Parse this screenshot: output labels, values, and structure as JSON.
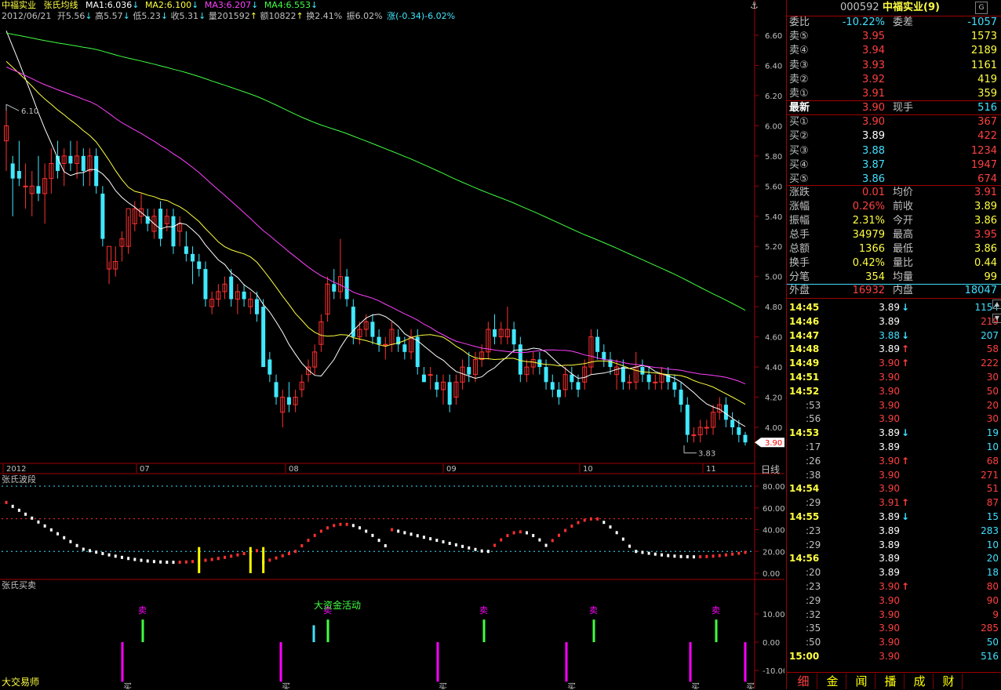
{
  "chart_header": {
    "stock_name": "中福实业",
    "indicator_name": "张氏均线",
    "ma1": "MA1:6.036",
    "ma2": "MA2:6.100",
    "ma3": "MA3:6.207",
    "ma4": "MA4:6.553",
    "date": "2012/06/21",
    "open": "开5.56",
    "high": "高5.57",
    "low": "低5.23",
    "close": "收5.31",
    "volume": "量201592",
    "amount": "额10822",
    "turnover": "换2.41%",
    "amplitude": "振6.02%",
    "change": "涨(-0.34)-6.02%"
  },
  "panels": {
    "wave_title": "张氏波段",
    "trade_title": "张氏买卖",
    "big_fund_label": "大资金活动",
    "bottom_left_label": "大交易师",
    "period_label": "日线",
    "current_price_tag": "3.90",
    "max_label": "6.10",
    "min_label": "3.83",
    "sell_mark": "卖",
    "buy_mark": "买",
    "top_icon": "anchor-icon"
  },
  "price_axis": [
    "6.60",
    "6.40",
    "6.20",
    "6.00",
    "5.80",
    "5.60",
    "5.40",
    "5.20",
    "5.00",
    "4.80",
    "4.60",
    "4.40",
    "4.20",
    "4.00"
  ],
  "wave_axis": [
    "80.00",
    "60.00",
    "40.00",
    "20.00",
    "0.00"
  ],
  "trade_axis": [
    "10.00",
    "0.00",
    "-10.00"
  ],
  "x_labels": [
    "2012",
    "07",
    "08",
    "09",
    "10",
    "11"
  ],
  "colors": {
    "up": "#ff3030",
    "down": "#40e8ff",
    "ma1": "#ffffff",
    "ma2": "#ffff40",
    "ma3": "#ff40ff",
    "ma4": "#40ff40",
    "grid": "#a00000",
    "buy": "#ff00ff",
    "sell": "#40ff40"
  },
  "chart_data": {
    "type": "candlestick",
    "ylim": [
      3.7,
      6.7
    ],
    "candles_ohlc": [
      [
        5.9,
        6.1,
        5.7,
        6.0
      ],
      [
        5.75,
        5.8,
        5.4,
        5.65
      ],
      [
        5.7,
        5.9,
        5.6,
        5.65
      ],
      [
        5.6,
        5.75,
        5.45,
        5.6
      ],
      [
        5.55,
        5.7,
        5.4,
        5.6
      ],
      [
        5.6,
        5.8,
        5.5,
        5.55
      ],
      [
        5.55,
        5.75,
        5.35,
        5.65
      ],
      [
        5.65,
        5.85,
        5.55,
        5.75
      ],
      [
        5.8,
        5.9,
        5.65,
        5.7
      ],
      [
        5.75,
        5.85,
        5.6,
        5.8
      ],
      [
        5.8,
        5.9,
        5.7,
        5.75
      ],
      [
        5.75,
        5.9,
        5.65,
        5.8
      ],
      [
        5.8,
        5.85,
        5.6,
        5.7
      ],
      [
        5.7,
        5.85,
        5.6,
        5.8
      ],
      [
        5.8,
        5.85,
        5.55,
        5.6
      ],
      [
        5.55,
        5.6,
        5.2,
        5.25
      ],
      [
        5.05,
        5.1,
        4.95,
        5.2
      ],
      [
        5.05,
        5.2,
        5.0,
        5.1
      ],
      [
        5.2,
        5.3,
        5.1,
        5.25
      ],
      [
        5.2,
        5.4,
        5.15,
        5.45
      ],
      [
        5.35,
        5.5,
        5.3,
        5.45
      ],
      [
        5.4,
        5.55,
        5.35,
        5.45
      ],
      [
        5.4,
        5.45,
        5.3,
        5.35
      ],
      [
        5.3,
        5.45,
        5.25,
        5.4
      ],
      [
        5.45,
        5.5,
        5.2,
        5.25
      ],
      [
        5.35,
        5.45,
        5.3,
        5.4
      ],
      [
        5.4,
        5.45,
        5.15,
        5.2
      ],
      [
        5.3,
        5.4,
        5.2,
        5.35
      ],
      [
        5.2,
        5.3,
        5.1,
        5.15
      ],
      [
        5.15,
        5.2,
        4.95,
        5.1
      ],
      [
        5.1,
        5.15,
        5.0,
        5.05
      ],
      [
        5.05,
        5.1,
        4.8,
        4.85
      ],
      [
        4.8,
        4.9,
        4.75,
        4.85
      ],
      [
        4.85,
        4.95,
        4.8,
        4.9
      ],
      [
        4.9,
        5.0,
        4.85,
        4.95
      ],
      [
        5.0,
        5.05,
        4.8,
        4.85
      ],
      [
        4.85,
        4.95,
        4.75,
        4.9
      ],
      [
        4.9,
        4.95,
        4.8,
        4.85
      ],
      [
        4.8,
        4.9,
        4.75,
        4.85
      ],
      [
        4.85,
        4.9,
        4.7,
        4.75
      ],
      [
        4.8,
        4.85,
        4.4,
        4.4
      ],
      [
        4.45,
        4.5,
        4.3,
        4.35
      ],
      [
        4.3,
        4.35,
        4.15,
        4.2
      ],
      [
        4.1,
        4.25,
        4.0,
        4.2
      ],
      [
        4.2,
        4.3,
        4.1,
        4.15
      ],
      [
        4.15,
        4.25,
        4.1,
        4.2
      ],
      [
        4.25,
        4.35,
        4.2,
        4.3
      ],
      [
        4.35,
        4.45,
        4.3,
        4.4
      ],
      [
        4.4,
        4.55,
        4.35,
        4.5
      ],
      [
        4.55,
        4.75,
        4.5,
        4.7
      ],
      [
        4.75,
        5.0,
        4.7,
        4.95
      ],
      [
        4.95,
        5.05,
        4.85,
        4.9
      ],
      [
        4.9,
        5.25,
        4.85,
        5.0
      ],
      [
        5.0,
        5.05,
        4.8,
        4.85
      ],
      [
        4.8,
        4.85,
        4.55,
        4.6
      ],
      [
        4.6,
        4.7,
        4.55,
        4.65
      ],
      [
        4.65,
        4.75,
        4.6,
        4.7
      ],
      [
        4.7,
        4.75,
        4.55,
        4.6
      ],
      [
        4.6,
        4.65,
        4.5,
        4.55
      ],
      [
        4.55,
        4.6,
        4.45,
        4.55
      ],
      [
        4.55,
        4.7,
        4.5,
        4.65
      ],
      [
        4.6,
        4.65,
        4.5,
        4.55
      ],
      [
        4.55,
        4.6,
        4.45,
        4.5
      ],
      [
        4.5,
        4.65,
        4.45,
        4.6
      ],
      [
        4.6,
        4.65,
        4.35,
        4.4
      ],
      [
        4.35,
        4.4,
        4.3,
        4.3
      ],
      [
        4.35,
        4.4,
        4.25,
        4.35
      ],
      [
        4.3,
        4.35,
        4.2,
        4.25
      ],
      [
        4.25,
        4.35,
        4.15,
        4.3
      ],
      [
        4.3,
        4.35,
        4.1,
        4.15
      ],
      [
        4.2,
        4.35,
        4.15,
        4.3
      ],
      [
        4.3,
        4.45,
        4.25,
        4.4
      ],
      [
        4.4,
        4.5,
        4.3,
        4.35
      ],
      [
        4.35,
        4.5,
        4.3,
        4.45
      ],
      [
        4.45,
        4.55,
        4.4,
        4.5
      ],
      [
        4.5,
        4.7,
        4.45,
        4.65
      ],
      [
        4.65,
        4.75,
        4.55,
        4.6
      ],
      [
        4.6,
        4.7,
        4.55,
        4.65
      ],
      [
        4.6,
        4.8,
        4.55,
        4.65
      ],
      [
        4.65,
        4.7,
        4.5,
        4.55
      ],
      [
        4.55,
        4.6,
        4.3,
        4.35
      ],
      [
        4.35,
        4.45,
        4.3,
        4.4
      ],
      [
        4.4,
        4.5,
        4.35,
        4.45
      ],
      [
        4.45,
        4.5,
        4.35,
        4.4
      ],
      [
        4.4,
        4.45,
        4.25,
        4.3
      ],
      [
        4.3,
        4.35,
        4.2,
        4.25
      ],
      [
        4.25,
        4.3,
        4.15,
        4.2
      ],
      [
        4.25,
        4.4,
        4.2,
        4.35
      ],
      [
        4.35,
        4.4,
        4.25,
        4.3
      ],
      [
        4.3,
        4.35,
        4.2,
        4.25
      ],
      [
        4.3,
        4.45,
        4.25,
        4.4
      ],
      [
        4.4,
        4.65,
        4.35,
        4.6
      ],
      [
        4.6,
        4.65,
        4.45,
        4.5
      ],
      [
        4.5,
        4.55,
        4.4,
        4.45
      ],
      [
        4.45,
        4.5,
        4.35,
        4.4
      ],
      [
        4.35,
        4.45,
        4.25,
        4.4
      ],
      [
        4.4,
        4.45,
        4.25,
        4.3
      ],
      [
        4.3,
        4.35,
        4.25,
        4.3
      ],
      [
        4.3,
        4.5,
        4.25,
        4.4
      ],
      [
        4.4,
        4.45,
        4.3,
        4.35
      ],
      [
        4.35,
        4.4,
        4.25,
        4.3
      ],
      [
        4.3,
        4.35,
        4.25,
        4.3
      ],
      [
        4.3,
        4.4,
        4.25,
        4.35
      ],
      [
        4.35,
        4.4,
        4.25,
        4.3
      ],
      [
        4.3,
        4.35,
        4.2,
        4.25
      ],
      [
        4.25,
        4.3,
        4.1,
        4.15
      ],
      [
        4.15,
        4.2,
        3.9,
        3.95
      ],
      [
        3.95,
        4.0,
        3.9,
        3.95
      ],
      [
        3.95,
        4.05,
        3.9,
        4.0
      ],
      [
        4.0,
        4.05,
        3.95,
        4.0
      ],
      [
        4.0,
        4.15,
        3.95,
        4.1
      ],
      [
        4.1,
        4.2,
        4.05,
        4.15
      ],
      [
        4.15,
        4.2,
        4.0,
        4.05
      ],
      [
        4.05,
        4.1,
        3.95,
        4.0
      ],
      [
        4.0,
        4.05,
        3.9,
        3.95
      ],
      [
        3.95,
        3.97,
        3.88,
        3.9
      ]
    ]
  },
  "quote": {
    "code": "000592",
    "name": "中福实业(9)",
    "webi_label": "委比",
    "webi_val": "-10.22%",
    "weicha_label": "委差",
    "weicha_val": "-1057",
    "sell5_label": "卖⑤",
    "sell5_price": "3.95",
    "sell5_vol": "1573",
    "sell4_label": "卖④",
    "sell4_price": "3.94",
    "sell4_vol": "2189",
    "sell3_label": "卖③",
    "sell3_price": "3.93",
    "sell3_vol": "1161",
    "sell2_label": "卖②",
    "sell2_price": "3.92",
    "sell2_vol": "419",
    "sell1_label": "卖①",
    "sell1_price": "3.91",
    "sell1_vol": "359",
    "last_label": "最新",
    "last_price": "3.90",
    "xianshou_label": "现手",
    "xianshou_val": "516",
    "buy1_label": "买①",
    "buy1_price": "3.90",
    "buy1_vol": "367",
    "buy2_label": "买②",
    "buy2_price": "3.89",
    "buy2_vol": "422",
    "buy3_label": "买③",
    "buy3_price": "3.88",
    "buy3_vol": "1234",
    "buy4_label": "买④",
    "buy4_price": "3.87",
    "buy4_vol": "1947",
    "buy5_label": "买⑤",
    "buy5_price": "3.86",
    "buy5_vol": "674",
    "zhangdie_label": "涨跌",
    "zhangdie_val": "0.01",
    "junjia_label": "均价",
    "junjia_val": "3.91",
    "zhangfu_label": "涨幅",
    "zhangfu_val": "0.26%",
    "qianshou_label": "前收",
    "qianshou_val": "3.89",
    "zhenfu_label": "振幅",
    "zhenfu_val": "2.31%",
    "jinkai_label": "今开",
    "jinkai_val": "3.86",
    "zongshou_label": "总手",
    "zongshou_val": "34979",
    "zuigao_label": "最高",
    "zuigao_val": "3.95",
    "zonge_label": "总额",
    "zonge_val": "1366",
    "zuidi_label": "最低",
    "zuidi_val": "3.86",
    "huanshou_label": "换手",
    "huanshou_val": "0.42%",
    "liangbi_label": "量比",
    "liangbi_val": "0.44",
    "fenbi_label": "分笔",
    "fenbi_val": "354",
    "junliang_label": "均量",
    "junliang_val": "99",
    "waipan_label": "外盘",
    "waipan_val": "16932",
    "neipan_label": "内盘",
    "neipan_val": "18047"
  },
  "ticks": [
    {
      "time": "14:45",
      "price": "3.89",
      "arrow": "↓",
      "vol": "1154",
      "pc": "white",
      "vc": "cyan",
      "ac": "cyan",
      "bold": true
    },
    {
      "time": "14:46",
      "price": "3.89",
      "arrow": "",
      "vol": "219",
      "pc": "white",
      "vc": "red",
      "ac": "",
      "bold": true
    },
    {
      "time": "14:47",
      "price": "3.88",
      "arrow": "↓",
      "vol": "207",
      "pc": "cyan",
      "vc": "cyan",
      "ac": "cyan",
      "bold": true
    },
    {
      "time": "14:48",
      "price": "3.89",
      "arrow": "↑",
      "vol": "58",
      "pc": "white",
      "vc": "red",
      "ac": "red",
      "bold": true
    },
    {
      "time": "14:49",
      "price": "3.90",
      "arrow": "↑",
      "vol": "222",
      "pc": "red",
      "vc": "red",
      "ac": "red",
      "bold": true
    },
    {
      "time": "14:51",
      "price": "3.90",
      "arrow": "",
      "vol": "30",
      "pc": "red",
      "vc": "red",
      "ac": "",
      "bold": true
    },
    {
      "time": "14:52",
      "price": "3.90",
      "arrow": "",
      "vol": "50",
      "pc": "red",
      "vc": "red",
      "ac": "",
      "bold": true
    },
    {
      "time": ":53",
      "price": "3.90",
      "arrow": "",
      "vol": "20",
      "pc": "red",
      "vc": "red",
      "ac": "",
      "bold": false
    },
    {
      "time": ":56",
      "price": "3.90",
      "arrow": "",
      "vol": "30",
      "pc": "red",
      "vc": "red",
      "ac": "",
      "bold": false
    },
    {
      "time": "14:53",
      "price": "3.89",
      "arrow": "↓",
      "vol": "19",
      "pc": "white",
      "vc": "cyan",
      "ac": "cyan",
      "bold": true
    },
    {
      "time": ":17",
      "price": "3.89",
      "arrow": "",
      "vol": "10",
      "pc": "white",
      "vc": "cyan",
      "ac": "",
      "bold": false
    },
    {
      "time": ":26",
      "price": "3.90",
      "arrow": "↑",
      "vol": "68",
      "pc": "red",
      "vc": "red",
      "ac": "red",
      "bold": false
    },
    {
      "time": ":38",
      "price": "3.90",
      "arrow": "",
      "vol": "271",
      "pc": "red",
      "vc": "red",
      "ac": "",
      "bold": false
    },
    {
      "time": "14:54",
      "price": "3.90",
      "arrow": "",
      "vol": "51",
      "pc": "red",
      "vc": "red",
      "ac": "",
      "bold": true
    },
    {
      "time": ":29",
      "price": "3.91",
      "arrow": "↑",
      "vol": "87",
      "pc": "red",
      "vc": "red",
      "ac": "red",
      "bold": false
    },
    {
      "time": "14:55",
      "price": "3.89",
      "arrow": "↓",
      "vol": "15",
      "pc": "white",
      "vc": "cyan",
      "ac": "cyan",
      "bold": true
    },
    {
      "time": ":23",
      "price": "3.89",
      "arrow": "",
      "vol": "283",
      "pc": "white",
      "vc": "cyan",
      "ac": "",
      "bold": false
    },
    {
      "time": ":29",
      "price": "3.89",
      "arrow": "",
      "vol": "10",
      "pc": "white",
      "vc": "cyan",
      "ac": "",
      "bold": false
    },
    {
      "time": "14:56",
      "price": "3.89",
      "arrow": "",
      "vol": "20",
      "pc": "white",
      "vc": "cyan",
      "ac": "",
      "bold": true
    },
    {
      "time": ":20",
      "price": "3.89",
      "arrow": "",
      "vol": "18",
      "pc": "white",
      "vc": "cyan",
      "ac": "",
      "bold": false
    },
    {
      "time": ":23",
      "price": "3.90",
      "arrow": "↑",
      "vol": "80",
      "pc": "red",
      "vc": "red",
      "ac": "red",
      "bold": false
    },
    {
      "time": ":29",
      "price": "3.90",
      "arrow": "",
      "vol": "90",
      "pc": "red",
      "vc": "red",
      "ac": "",
      "bold": false
    },
    {
      "time": ":32",
      "price": "3.90",
      "arrow": "",
      "vol": "9",
      "pc": "red",
      "vc": "red",
      "ac": "",
      "bold": false
    },
    {
      "time": ":35",
      "price": "3.90",
      "arrow": "",
      "vol": "285",
      "pc": "red",
      "vc": "red",
      "ac": "",
      "bold": false
    },
    {
      "time": ":50",
      "price": "3.90",
      "arrow": "",
      "vol": "50",
      "pc": "red",
      "vc": "cyan",
      "ac": "",
      "bold": false
    },
    {
      "time": "15:00",
      "price": "3.90",
      "arrow": "",
      "vol": "516",
      "pc": "red",
      "vc": "cyan",
      "ac": "",
      "bold": true
    }
  ],
  "tabs": [
    "细",
    "金",
    "闻",
    "播",
    "成",
    "财"
  ]
}
